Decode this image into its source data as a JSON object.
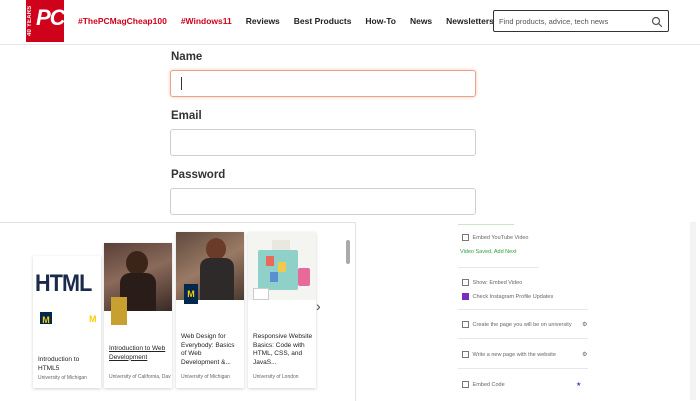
{
  "header": {
    "logo": {
      "years": "40 YEARS",
      "text": "PC"
    },
    "nav": [
      {
        "label": "#ThePCMagCheap100",
        "hot": true
      },
      {
        "label": "#Windows11",
        "hot": true
      },
      {
        "label": "Reviews",
        "hot": false
      },
      {
        "label": "Best Products",
        "hot": false
      },
      {
        "label": "How-To",
        "hot": false
      },
      {
        "label": "News",
        "hot": false
      },
      {
        "label": "Newsletters",
        "hot": false
      }
    ],
    "search": {
      "placeholder": "Find products, advice, tech news",
      "icon": "search-icon"
    }
  },
  "form": {
    "name_label": "Name",
    "name_value": "",
    "email_label": "Email",
    "email_value": "",
    "password_label": "Password",
    "password_value": ""
  },
  "courses": [
    {
      "title": "Introduction to HTML5",
      "university": "University of Michigan",
      "thumb_text": "HTML"
    },
    {
      "title": "Introduction to Web Development",
      "university": "University of California, Davis",
      "thumb_text": ""
    },
    {
      "title": "Web Design for Everybody: Basics of Web Development &...",
      "university": "University of Michigan",
      "thumb_text": ""
    },
    {
      "title": "Responsive Website Basics: Code with HTML, CSS, and JavaS...",
      "university": "University of London",
      "thumb_text": ""
    }
  ],
  "sidebar": {
    "items": [
      {
        "label": "Embed YouTube Video",
        "icon": "embed-icon",
        "tag": ""
      },
      {
        "label": "Video Saved, Add Next",
        "icon": "",
        "tag": ""
      },
      {
        "label": "Show: Embed Video",
        "icon": "video-icon",
        "tag": ""
      },
      {
        "label": "Check Instagram Profile Updates",
        "icon": "instagram-icon",
        "tag": ""
      },
      {
        "label": "Create the page you will be on university",
        "icon": "page-icon",
        "tag": ""
      },
      {
        "label": "Write a new page with the website",
        "icon": "page-icon",
        "tag": ""
      },
      {
        "label": "Embed Code",
        "icon": "code-icon",
        "tag": ""
      }
    ]
  },
  "colors": {
    "brand": "#d0021b",
    "focus": "#e8a58c",
    "umich_blue": "#00274c",
    "umich_maize": "#ffcb05"
  }
}
